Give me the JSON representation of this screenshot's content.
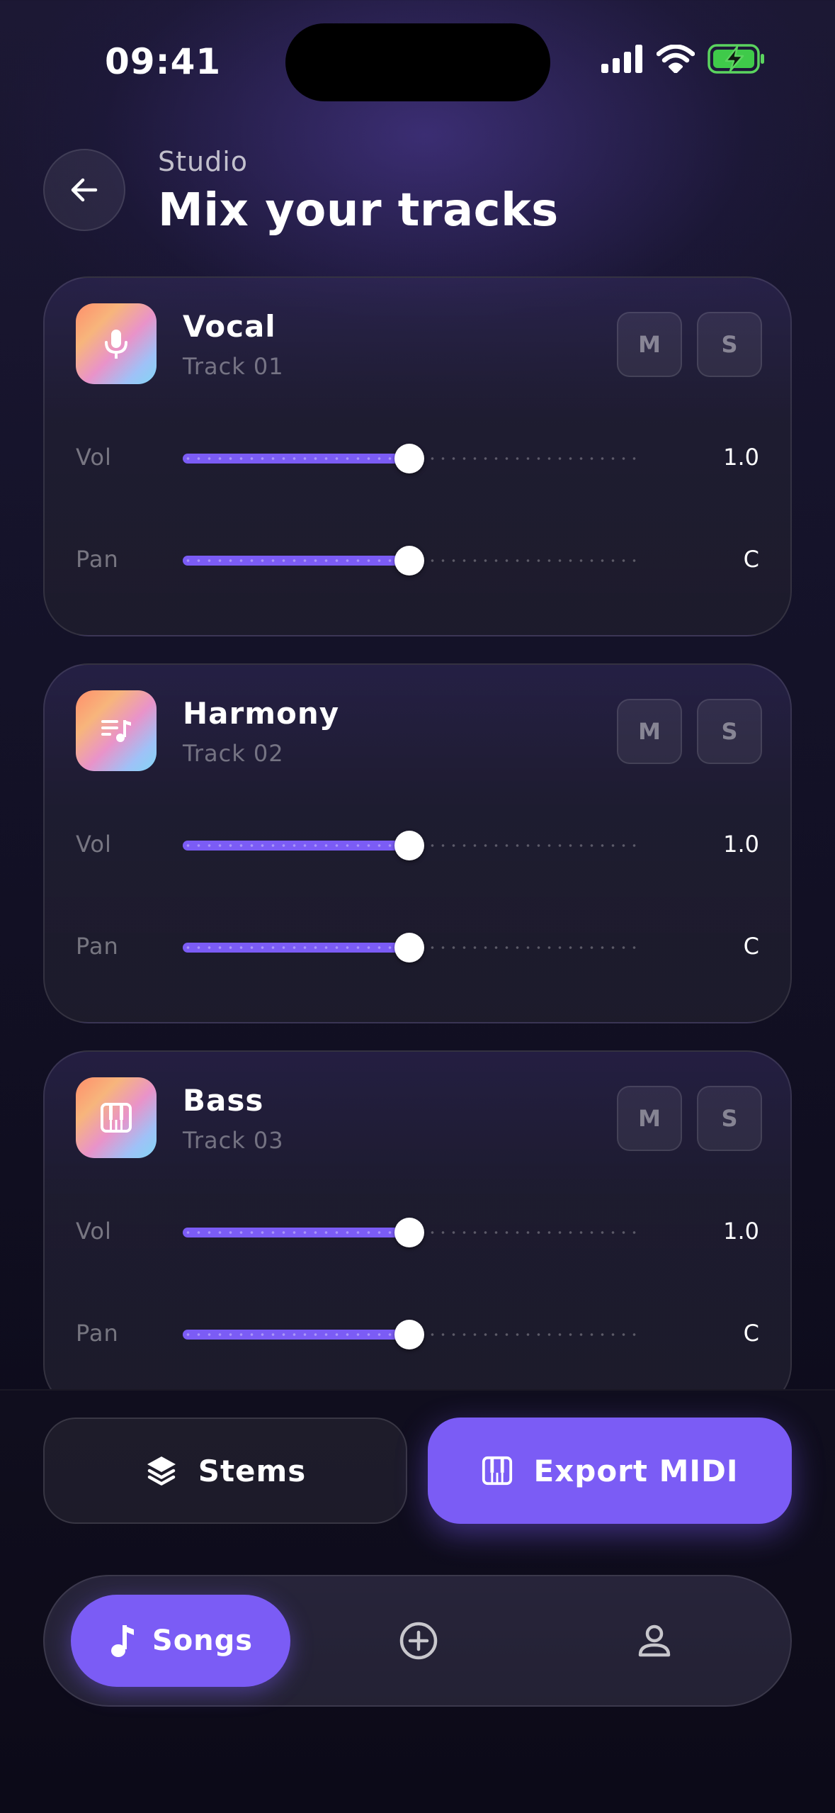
{
  "status_bar": {
    "time": "09:41",
    "icons": [
      "cellular-signal-icon",
      "wifi-icon",
      "battery-charging-icon"
    ]
  },
  "header": {
    "back_icon": "arrow-left-icon",
    "subtitle": "Studio",
    "title": "Mix your tracks"
  },
  "tracks": [
    {
      "name": "Vocal",
      "number": "Track 01",
      "icon": "microphone-icon",
      "mute_label": "M",
      "solo_label": "S",
      "vol_label": "Vol",
      "vol_value": "1.0",
      "vol_level": 0.5,
      "pan_label": "Pan",
      "pan_value": "C",
      "pan_level": 0.5
    },
    {
      "name": "Harmony",
      "number": "Track 02",
      "icon": "playlist-music-icon",
      "mute_label": "M",
      "solo_label": "S",
      "vol_label": "Vol",
      "vol_value": "1.0",
      "vol_level": 0.5,
      "pan_label": "Pan",
      "pan_value": "C",
      "pan_level": 0.5
    },
    {
      "name": "Bass",
      "number": "Track 03",
      "icon": "piano-icon",
      "mute_label": "M",
      "solo_label": "S",
      "vol_label": "Vol",
      "vol_value": "1.0",
      "vol_level": 0.5,
      "pan_label": "Pan",
      "pan_value": "C",
      "pan_level": 0.5
    }
  ],
  "actions": {
    "stems_label": "Stems",
    "stems_icon": "layers-icon",
    "export_label": "Export MIDI",
    "export_icon": "piano-icon"
  },
  "tab_bar": {
    "active_label": "Songs",
    "active_icon": "music-note-icon",
    "create_icon": "plus-circle-icon",
    "profile_icon": "user-icon"
  },
  "colors": {
    "accent": "#7b5cf5",
    "background": "#100e20",
    "card": "#1e1c2c"
  }
}
